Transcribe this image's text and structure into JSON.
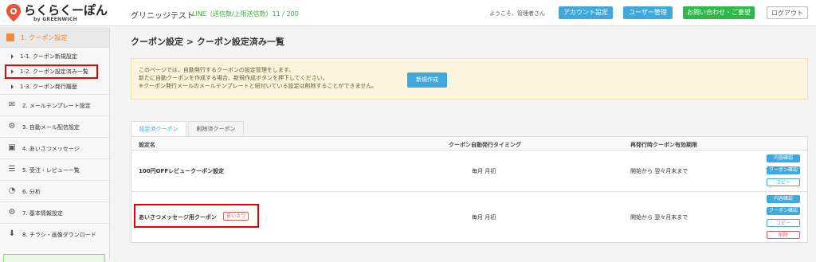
{
  "header": {
    "logo_text": "らくらくーぽん",
    "logo_sub": "by GREENWICH",
    "shop_name": "グリニッジテスト",
    "line_count": "LINE（送信数/上限送信数）11 / 200",
    "welcome": "ようこそ、管理者さん",
    "account_btn": "アカウント設定",
    "users_btn": "ユーザー管理",
    "contact_btn": "お問い合わせ・ご要望",
    "logout_btn": "ログアウト"
  },
  "sidebar": {
    "active": "1. クーポン設定",
    "sub_items": [
      "1-1. クーポン新規設定",
      "1-2. クーポン設定済み一覧",
      "1-3. クーポン発行履歴"
    ],
    "menu": [
      {
        "icon": "mail-icon",
        "label": "2. メールテンプレート設定"
      },
      {
        "icon": "gears-icon",
        "label": "3. 自動メール配信設定"
      },
      {
        "icon": "message-icon",
        "label": "4. あいさつメッセージ"
      },
      {
        "icon": "list-icon",
        "label": "5. 受注・レビュー一覧"
      },
      {
        "icon": "pie-icon",
        "label": "6. 分析"
      },
      {
        "icon": "gear-icon",
        "label": "7. 基本情報設定"
      },
      {
        "icon": "download-icon",
        "label": "8. チラシ・画像ダウンロード"
      }
    ]
  },
  "main": {
    "title": "クーポン設定 > クーポン設定済み一覧",
    "info_lines": [
      "このページでは、自動発行するクーポンの設定管理をします。",
      "新たに自動クーポンを作成する場合、新規作成ボタンを押下してください。",
      "※クーポン発行メールのメールテンプレートと紐付いている設定は削除することができません。"
    ],
    "new_btn": "新規作成",
    "tabs": [
      "設定済クーポン",
      "削除済クーポン"
    ],
    "columns": [
      "設定名",
      "クーポン自動発行タイミング",
      "再発行時クーポン有効期限"
    ],
    "rows": [
      {
        "name": "100円OFFレビュークーポン設定",
        "timing": "毎月 月初",
        "expiry": "開始から 翌々月末まで",
        "badge": ""
      },
      {
        "name": "あいさつメッセージ用クーポン",
        "timing": "毎月 月初",
        "expiry": "開始から 翌々月末まで",
        "badge": "あいさつ"
      }
    ],
    "actions": {
      "content": "内容確認",
      "coupon": "クーポン確認",
      "copy": "コピー",
      "delete": "削除"
    }
  },
  "colors": {
    "accent": "#3fa8dd",
    "active": "#e8823a",
    "highlight": "#e60000",
    "green": "#2fb84a"
  }
}
